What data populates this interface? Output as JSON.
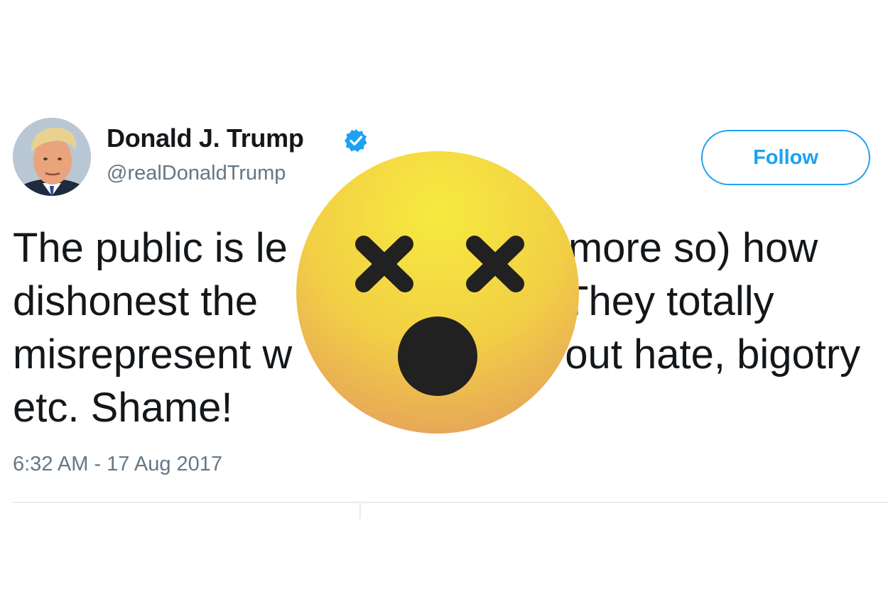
{
  "tweet": {
    "display_name": "Donald J. Trump",
    "handle": "@realDonaldTrump",
    "text_lines": [
      "The public is le",
      "more so) how",
      "dishonest the",
      "They totally",
      "misrepresent w",
      "out hate, bigotry",
      "etc. Shame!"
    ],
    "timestamp": "6:32 AM - 17 Aug 2017"
  },
  "actions": {
    "follow_label": "Follow"
  },
  "icons": {
    "verified": "verified-badge-icon",
    "overlay": "dizzy-face-emoji-icon"
  },
  "colors": {
    "accent": "#1da1f2",
    "text_primary": "#14171a",
    "text_secondary": "#657786",
    "emoji_top": "#f6e84a",
    "emoji_bottom": "#e8a85a",
    "emoji_features": "#212121"
  }
}
